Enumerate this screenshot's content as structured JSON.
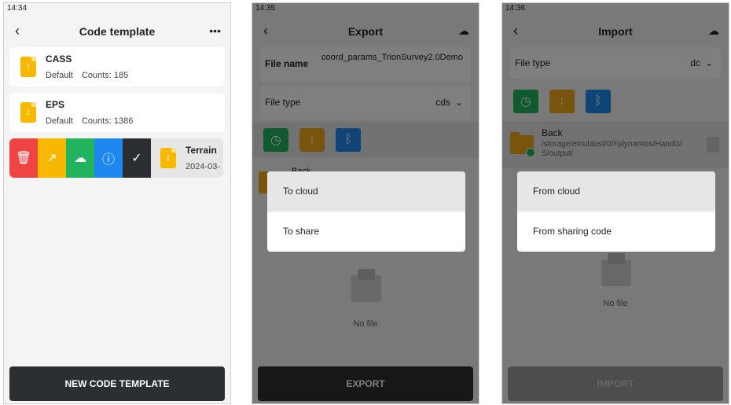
{
  "screen1": {
    "status_time": "14:34",
    "title": "Code template",
    "more_icon_label": "•••",
    "items": [
      {
        "name": "CASS",
        "tag": "Default",
        "counts": "Counts: 185"
      },
      {
        "name": "EPS",
        "tag": "Default",
        "counts": "Counts: 1386"
      }
    ],
    "swiped_item": {
      "name": "Terrain",
      "date": "2024-03-"
    },
    "actions": [
      "delete-icon",
      "share-icon",
      "upload-cloud-icon",
      "info-icon",
      "check-icon"
    ],
    "bottom_button": "NEW CODE TEMPLATE"
  },
  "screen2": {
    "status_time": "14:35",
    "title": "Export",
    "file_name_label": "File name",
    "file_name_value": "coord_params_TrionSurvey2.0Demo",
    "file_type_label": "File type",
    "file_type_value": "cds",
    "folder_partial": "Back",
    "no_file": "No file",
    "menu": [
      "To cloud",
      "To share"
    ],
    "bottom_button": "EXPORT"
  },
  "screen3": {
    "status_time": "14:36",
    "title": "Import",
    "file_type_label": "File type",
    "file_type_value": "dc",
    "folder_name": "Back",
    "folder_path": "/storage/emulated/0/Fjdynamics/HandGIS/output/",
    "no_file": "No file",
    "menu": [
      "From cloud",
      "From sharing code"
    ],
    "bottom_button": "IMPORT"
  },
  "colors": {
    "dark": "#2b2e33",
    "red": "#f04444",
    "yellow": "#f9b800",
    "green": "#22b35e",
    "blue": "#1e88f0"
  }
}
